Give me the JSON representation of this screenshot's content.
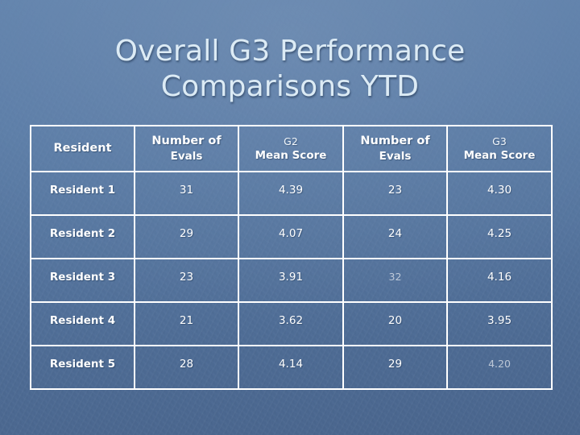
{
  "slide": {
    "background_color": "#55759f",
    "title_color": "#dcebf5",
    "table_border_color": "#ffffff",
    "text_color": "#ffffff"
  },
  "title": {
    "line1": "Overall G3 Performance",
    "line2": "Comparisons YTD"
  },
  "table": {
    "headers": [
      {
        "strong": "Resident",
        "small": "",
        "sub": ""
      },
      {
        "strong": "Number of",
        "small": "",
        "sub": "Evals"
      },
      {
        "strong": "",
        "small": "G2",
        "sub": "Mean Score"
      },
      {
        "strong": "Number of",
        "small": "",
        "sub": "Evals"
      },
      {
        "strong": "",
        "small": "G3",
        "sub": "Mean Score"
      }
    ],
    "rows": [
      {
        "resident": "Resident 1",
        "g2_evals": "31",
        "g2_mean": "4.39",
        "g3_evals": "23",
        "g3_mean": "4.30",
        "g3_evals_faint": false,
        "g3_mean_faint": false
      },
      {
        "resident": "Resident 2",
        "g2_evals": "29",
        "g2_mean": "4.07",
        "g3_evals": "24",
        "g3_mean": "4.25",
        "g3_evals_faint": false,
        "g3_mean_faint": false
      },
      {
        "resident": "Resident 3",
        "g2_evals": "23",
        "g2_mean": "3.91",
        "g3_evals": "32",
        "g3_mean": "4.16",
        "g3_evals_faint": true,
        "g3_mean_faint": false
      },
      {
        "resident": "Resident 4",
        "g2_evals": "21",
        "g2_mean": "3.62",
        "g3_evals": "20",
        "g3_mean": "3.95",
        "g3_evals_faint": false,
        "g3_mean_faint": false
      },
      {
        "resident": "Resident 5",
        "g2_evals": "28",
        "g2_mean": "4.14",
        "g3_evals": "29",
        "g3_mean": "4.20",
        "g3_evals_faint": false,
        "g3_mean_faint": true
      }
    ]
  }
}
